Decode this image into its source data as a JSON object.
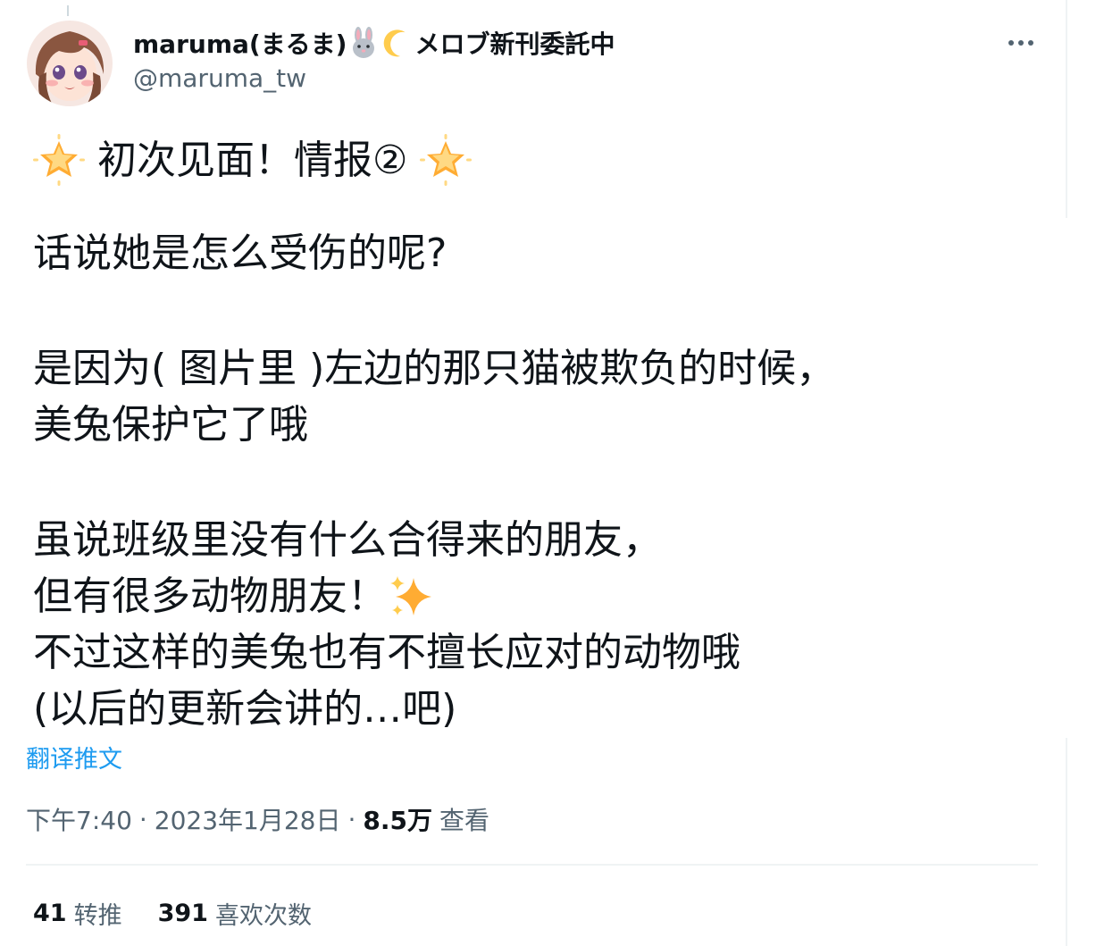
{
  "header": {
    "display_name_prefix": "maruma(まるま)",
    "display_name_suffix": "メロブ新刊委託中",
    "handle": "@maruma_tw",
    "name_icons": [
      "rabbit-emoji-icon",
      "crescent-moon-emoji-icon"
    ]
  },
  "tweet": {
    "title": "初次见面！情报②",
    "lines": [
      "话说她是怎么受伤的呢?",
      "是因为( 图片里 )左边的那只猫被欺负的时候，",
      "美兔保护它了哦",
      "虽说班级里没有什么合得来的朋友，",
      "但有很多动物朋友！",
      "不过这样的美兔也有不擅长应对的动物哦",
      "(以后的更新会讲的…吧)"
    ],
    "decorations": [
      "glowing-star-emoji-icon",
      "sparkles-emoji-icon"
    ]
  },
  "translate_link": "翻译推文",
  "meta": {
    "time": "下午7:40",
    "date": "2023年1月28日",
    "views_count": "8.5万",
    "views_label": "查看",
    "separator": "·"
  },
  "stats": {
    "retweets_count": "41",
    "retweets_label": "转推",
    "likes_count": "391",
    "likes_label": "喜欢次数"
  },
  "colors": {
    "text": "#0f1419",
    "secondary": "#536471",
    "link": "#1d9bf0",
    "divider": "#eff3f4"
  }
}
